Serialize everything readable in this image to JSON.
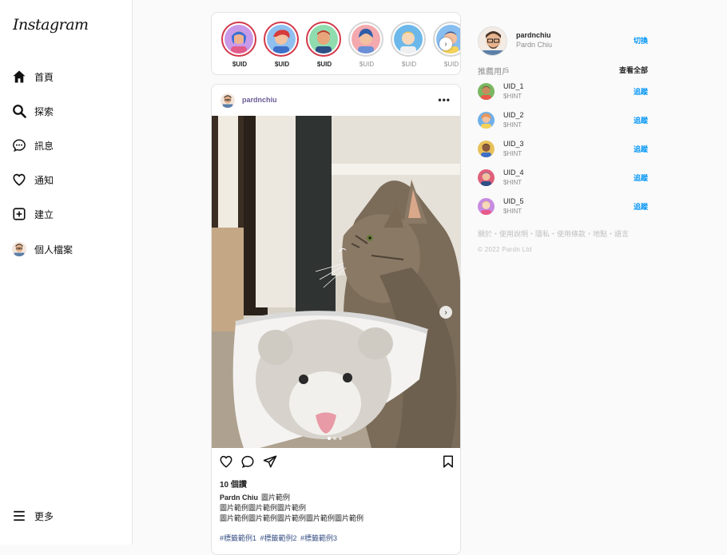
{
  "app": {
    "logo": "Instagram"
  },
  "nav": {
    "items": [
      {
        "label": "首頁",
        "icon": "home-icon"
      },
      {
        "label": "探索",
        "icon": "search-icon"
      },
      {
        "label": "訊息",
        "icon": "message-icon"
      },
      {
        "label": "通知",
        "icon": "heart-icon"
      },
      {
        "label": "建立",
        "icon": "plus-square-icon"
      },
      {
        "label": "個人檔案",
        "icon": "profile-avatar"
      }
    ],
    "more": {
      "label": "更多",
      "icon": "menu-icon"
    }
  },
  "stories": [
    {
      "label": "$UID",
      "seen": false,
      "color": "#b983e6"
    },
    {
      "label": "$UID",
      "seen": false,
      "color": "#6fa8e8"
    },
    {
      "label": "$UID",
      "seen": false,
      "color": "#79d49a"
    },
    {
      "label": "$UID",
      "seen": true,
      "color": "#f09aa0"
    },
    {
      "label": "$UID",
      "seen": true,
      "color": "#5fb0e6"
    },
    {
      "label": "$UID",
      "seen": true,
      "color": "#7cb4ec"
    }
  ],
  "post": {
    "username": "pardnchiu",
    "likes": "10 個讚",
    "caption_user": "Pardn Chiu",
    "caption_line1": "圖片範例",
    "caption_line2": "圖片範例圖片範例圖片範例",
    "caption_line3": "圖片範例圖片範例圖片範例圖片範例圖片範例",
    "tags": "#標籤範例1 #標籤範例2 #標籤範例3"
  },
  "profile": {
    "username": "pardnchiu",
    "fullname": "Pardn Chiu",
    "switch_label": "切換"
  },
  "suggestions": {
    "title": "推薦用戶",
    "see_all": "查看全部",
    "items": [
      {
        "uid": "UID_1",
        "hint": "$HINT",
        "follow": "追蹤",
        "color": "#7bb661"
      },
      {
        "uid": "UID_2",
        "hint": "$HINT",
        "follow": "追蹤",
        "color": "#6fb0ea"
      },
      {
        "uid": "UID_3",
        "hint": "$HINT",
        "follow": "追蹤",
        "color": "#e8c15a"
      },
      {
        "uid": "UID_4",
        "hint": "$HINT",
        "follow": "追蹤",
        "color": "#e0607a"
      },
      {
        "uid": "UID_5",
        "hint": "$HINT",
        "follow": "追蹤",
        "color": "#c78be0"
      }
    ]
  },
  "footer": {
    "links": "關於・使用說明・隱私・使用條款・地點・語言",
    "copyright": "© 2022 Pardn Ltd"
  }
}
